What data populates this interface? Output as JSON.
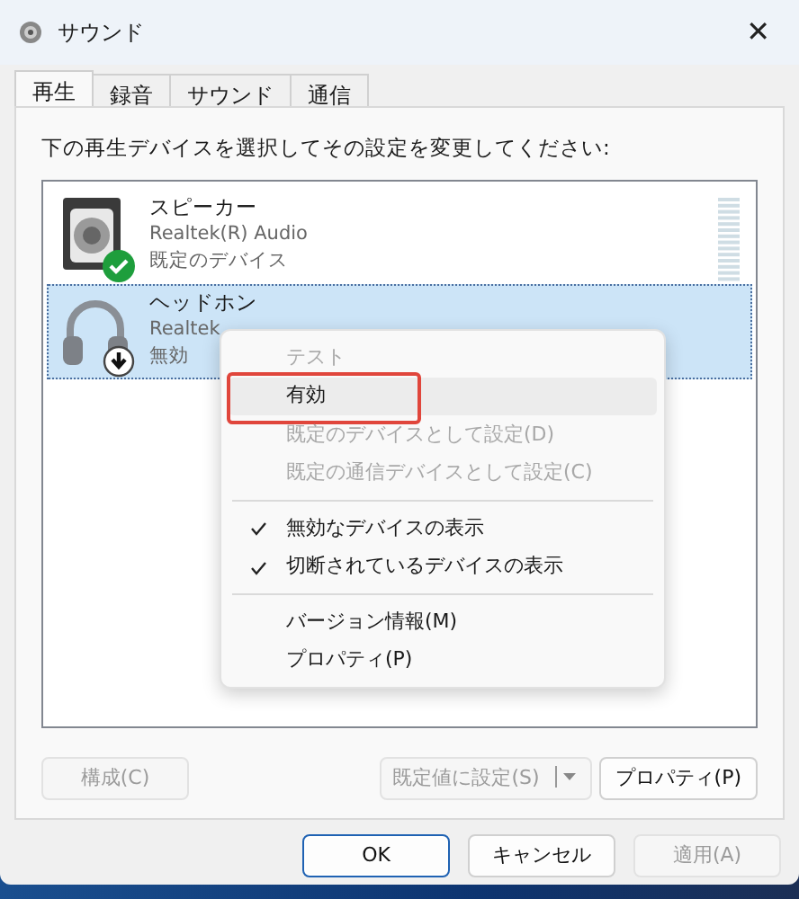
{
  "window": {
    "title": "サウンド",
    "close": "✕"
  },
  "tabs": [
    {
      "label": "再生",
      "selected": true
    },
    {
      "label": "録音",
      "selected": false
    },
    {
      "label": "サウンド",
      "selected": false
    },
    {
      "label": "通信",
      "selected": false
    }
  ],
  "instruction": "下の再生デバイスを選択してその設定を変更してください:",
  "devices": [
    {
      "kind": "speaker",
      "name": "スピーカー",
      "driver": "Realtek(R) Audio",
      "status": "既定のデバイス",
      "default_device": true,
      "disabled": false,
      "selected": false
    },
    {
      "kind": "headphones",
      "name": "ヘッドホン",
      "driver": "Realtek",
      "status": "無効",
      "default_device": false,
      "disabled": true,
      "selected": true
    }
  ],
  "context_menu": {
    "items": [
      {
        "kind": "item",
        "label": "テスト",
        "disabled": true,
        "checked": false,
        "selected": false,
        "highlighted": false
      },
      {
        "kind": "item",
        "label": "有効",
        "disabled": false,
        "checked": false,
        "selected": true,
        "highlighted": true
      },
      {
        "kind": "item",
        "label": "既定のデバイスとして設定(D)",
        "disabled": true,
        "checked": false,
        "selected": false,
        "highlighted": false
      },
      {
        "kind": "item",
        "label": "既定の通信デバイスとして設定(C)",
        "disabled": true,
        "checked": false,
        "selected": false,
        "highlighted": false
      },
      {
        "kind": "separator"
      },
      {
        "kind": "item",
        "label": "無効なデバイスの表示",
        "disabled": false,
        "checked": true,
        "selected": false,
        "highlighted": false
      },
      {
        "kind": "item",
        "label": "切断されているデバイスの表示",
        "disabled": false,
        "checked": true,
        "selected": false,
        "highlighted": false
      },
      {
        "kind": "separator"
      },
      {
        "kind": "item",
        "label": "バージョン情報(M)",
        "disabled": false,
        "checked": false,
        "selected": false,
        "highlighted": false
      },
      {
        "kind": "item",
        "label": "プロパティ(P)",
        "disabled": false,
        "checked": false,
        "selected": false,
        "highlighted": false
      }
    ]
  },
  "panel_buttons": [
    {
      "label": "構成(C)",
      "disabled": true,
      "kind": "plain"
    },
    {
      "label": "既定値に設定(S)",
      "disabled": true,
      "kind": "split"
    },
    {
      "label": "プロパティ(P)",
      "disabled": false,
      "kind": "plain"
    }
  ],
  "dialog_buttons": [
    {
      "label": "OK",
      "disabled": false,
      "default": true
    },
    {
      "label": "キャンセル",
      "disabled": false,
      "default": false
    },
    {
      "label": "適用(A)",
      "disabled": true,
      "default": false
    }
  ]
}
